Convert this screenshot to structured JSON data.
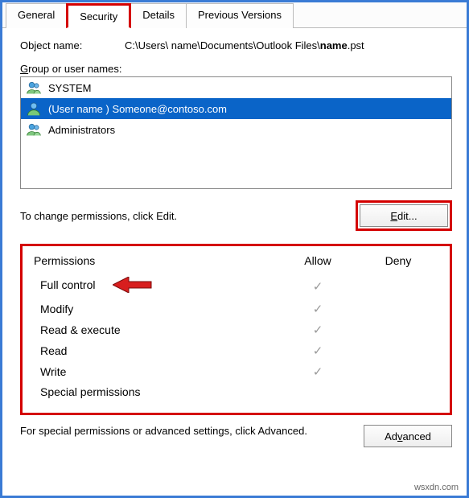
{
  "tabs": {
    "general": "General",
    "security": "Security",
    "details": "Details",
    "previous": "Previous Versions"
  },
  "object": {
    "label": "Object name:",
    "path_prefix": "C:\\Users\\ name\\Documents\\Outlook Files\\",
    "path_bold": "name",
    "path_suffix": ".pst"
  },
  "group": {
    "label_prefix_u": "G",
    "label_rest": "roup or user names:",
    "items": {
      "system": "SYSTEM",
      "user": "(User name ) Someone@contoso.com",
      "admins": "Administrators"
    }
  },
  "edit": {
    "text": "To change permissions, click Edit.",
    "button_u": "E",
    "button_rest": "dit..."
  },
  "perm": {
    "header_col1": "Permissions",
    "header_col2": "Allow",
    "header_col3": "Deny",
    "rows": {
      "full": "Full control",
      "modify": "Modify",
      "readexec": "Read & execute",
      "read": "Read",
      "write": "Write",
      "special": "Special permissions"
    }
  },
  "advanced": {
    "text": "For special permissions or advanced settings, click Advanced.",
    "button_pre": "Ad",
    "button_u": "v",
    "button_post": "anced"
  },
  "watermark": "wsxdn.com"
}
